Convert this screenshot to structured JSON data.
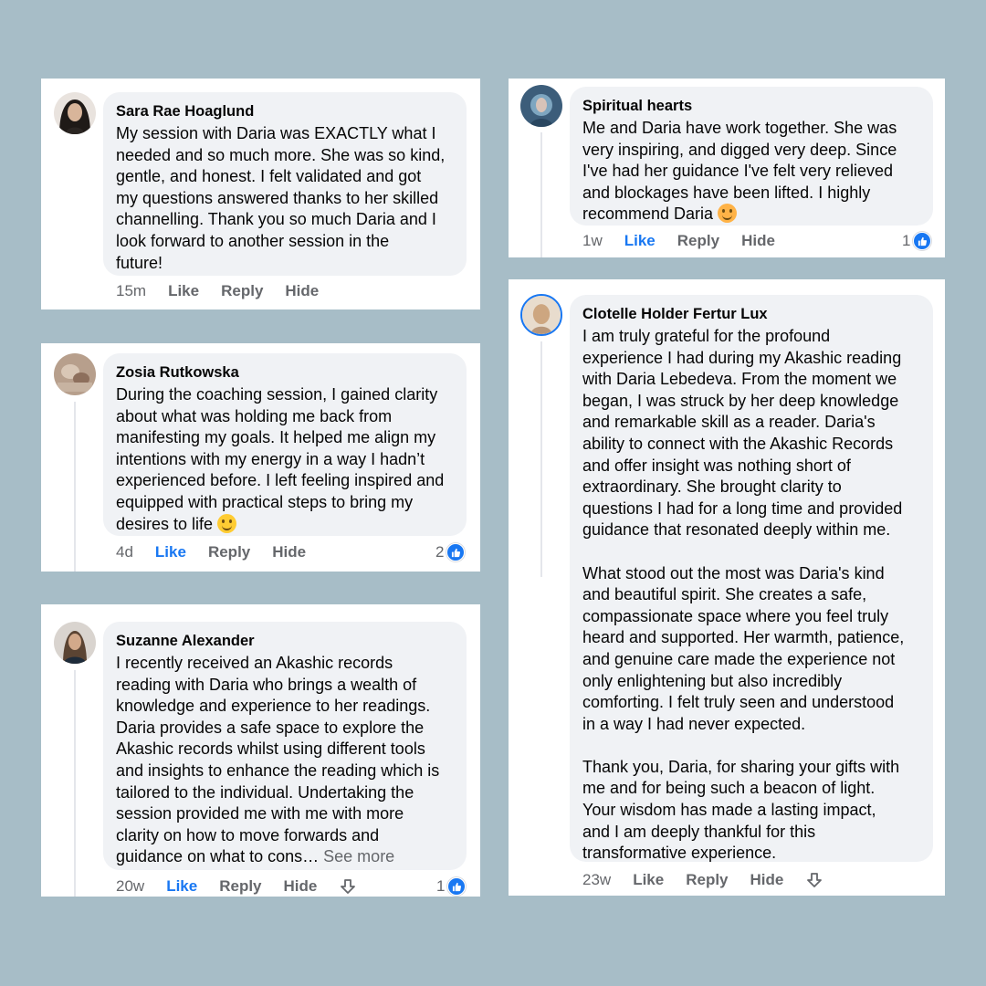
{
  "comments": [
    {
      "name": "Sara Rae Hoaglund",
      "text": "My session with Daria was EXACTLY what I\nneeded and so much more. She was so kind,\ngentle, and honest. I felt validated and got\nmy questions answered thanks to her skilled\nchannelling. Thank you so much Daria and I\nlook forward to another session in the\nfuture!",
      "time": "15m",
      "like": "Like",
      "reply": "Reply",
      "hide": "Hide",
      "avatar_color": "#2b2b2b"
    },
    {
      "name": "Zosia Rutkowska",
      "text": "During the coaching session, I gained clarity\nabout what was holding me back from\nmanifesting my goals. It helped me align my\nintentions with my energy in a way I hadn’t\nexperienced before. I left feeling inspired and\nequipped with practical steps to bring my\ndesires to life",
      "time": "4d",
      "like": "Like",
      "reply": "Reply",
      "hide": "Hide",
      "reaction_count": "2",
      "avatar_color": "#a08a78"
    },
    {
      "name": "Suzanne Alexander",
      "text": "I recently received an Akashic records\nreading with Daria who brings a wealth of\nknowledge and experience to her readings.\nDaria provides a safe space to explore the\nAkashic records whilst using different tools\nand insights to enhance the reading which is\ntailored to the individual.  Undertaking the\nsession provided me with me with more\nclarity on how to move forwards and\nguidance on what to cons… ",
      "see_more": "See more",
      "time": "20w",
      "like": "Like",
      "reply": "Reply",
      "hide": "Hide",
      "reaction_count": "1",
      "avatar_color": "#6b5a4a"
    },
    {
      "name": "Spiritual hearts",
      "text": "Me and Daria have work together. She was\nvery inspiring, and digged very deep. Since\nI've had her guidance I've felt very relieved\nand blockages have been lifted. I highly\nrecommend Daria",
      "time": "1w",
      "like": "Like",
      "reply": "Reply",
      "hide": "Hide",
      "reaction_count": "1",
      "avatar_color": "#4f6f8a"
    },
    {
      "name": "Clotelle Holder Fertur Lux",
      "text": "I am truly grateful for the profound\nexperience I had during my Akashic reading\nwith Daria Lebedeva. From the moment we\nbegan, I was struck by her deep knowledge\nand remarkable skill as a reader. Daria's\nability to connect with the Akashic Records\nand offer insight was nothing short of\nextraordinary. She brought clarity to\nquestions I had for a long time and provided\nguidance that resonated deeply within me.\n\nWhat stood out the most was Daria's kind\nand beautiful spirit. She creates a safe,\ncompassionate space where you feel truly\nheard and supported. Her warmth, patience,\nand genuine care made the experience not\nonly enlightening but also incredibly\ncomforting. I felt truly seen and understood\nin a way I had never expected.\n\nThank you, Daria, for sharing your gifts with\nme and for being such a beacon of light.\nYour wisdom has made a lasting impact,\nand I am deeply thankful for this\ntransformative experience.",
      "time": "23w",
      "like": "Like",
      "reply": "Reply",
      "hide": "Hide",
      "avatar_color": "#c9a98a"
    }
  ],
  "icons": {
    "reaction": "thumbs-up-icon",
    "down": "arrow-down-icon",
    "emoji": "smile-emoji-icon"
  },
  "colors": {
    "background": "#a7bdc7",
    "bubble": "#f0f2f5",
    "liked": "#1877f2",
    "muted": "#65676b"
  }
}
